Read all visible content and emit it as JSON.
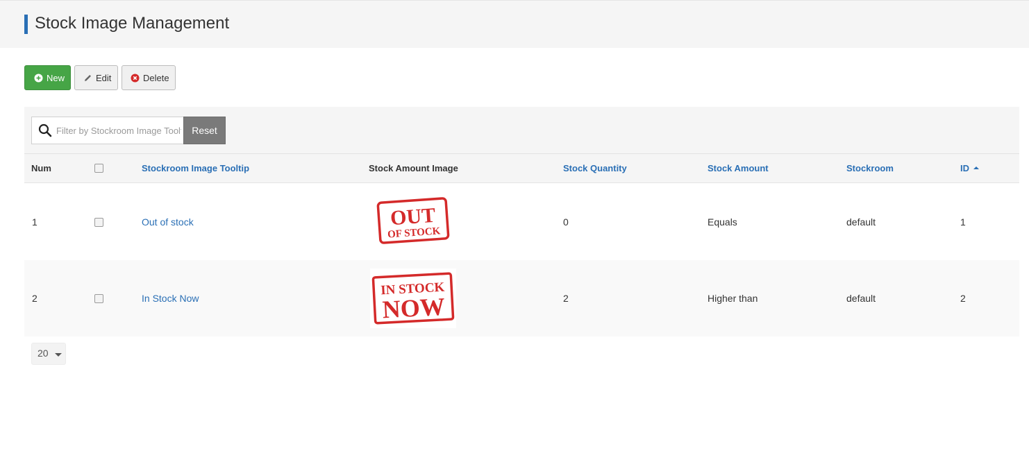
{
  "page": {
    "title": "Stock Image Management"
  },
  "toolbar": {
    "new_label": "New",
    "edit_label": "Edit",
    "delete_label": "Delete"
  },
  "filter": {
    "placeholder": "Filter by Stockroom Image Tooltip",
    "reset_label": "Reset"
  },
  "table": {
    "headers": {
      "num": "Num",
      "tooltip": "Stockroom Image Tooltip",
      "image": "Stock Amount Image",
      "quantity": "Stock Quantity",
      "amount": "Stock Amount",
      "stockroom": "Stockroom",
      "id": "ID"
    },
    "rows": [
      {
        "num": "1",
        "tooltip": "Out of stock",
        "stamp_line1": "OUT",
        "stamp_line2": "OF STOCK",
        "quantity": "0",
        "amount": "Equals",
        "stockroom": "default",
        "id": "1"
      },
      {
        "num": "2",
        "tooltip": "In Stock Now",
        "stamp_line1": "IN STOCK",
        "stamp_line2": "NOW",
        "quantity": "2",
        "amount": "Higher than",
        "stockroom": "default",
        "id": "2"
      }
    ]
  },
  "pagination": {
    "limit": "20"
  },
  "colors": {
    "accent": "#2a6fb5",
    "new_button": "#46a546",
    "stamp_red": "#d42a2a",
    "reset_button": "#7a7a7a"
  },
  "icons": {
    "new": "plus-circle-icon",
    "edit": "pencil-icon",
    "delete": "x-circle-icon",
    "search": "search-icon",
    "sort": "sort-asc-icon"
  }
}
